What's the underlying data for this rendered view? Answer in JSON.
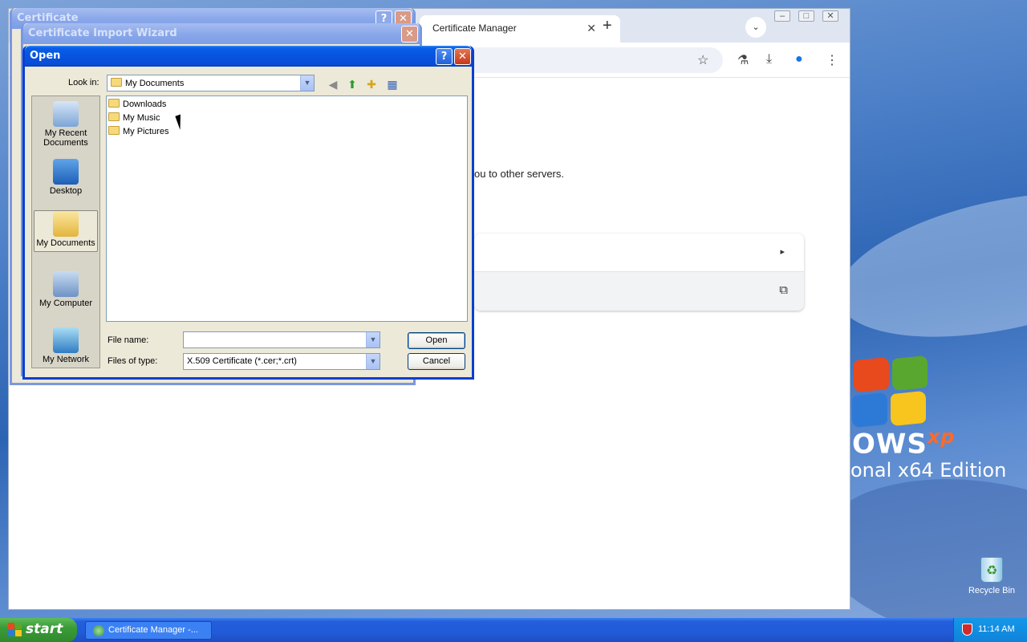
{
  "desktop": {
    "os_brand_text": "OWS",
    "os_brand_sup": "xp",
    "os_edition_text": "onal x64 Edition",
    "recycle_bin_label": "Recycle Bin"
  },
  "browser": {
    "tab_title": "Certificate Manager",
    "tab_close": "✕",
    "new_tab": "+",
    "tab_search": "⌄",
    "content_text": "ou to other servers.",
    "card_arrow": "▸",
    "card_external": "⧉"
  },
  "wizard_back": {
    "title": "Certificate Import Wizard",
    "behind_title": "Certificate"
  },
  "open_dialog": {
    "title": "Open",
    "help_btn": "?",
    "close_btn": "✕",
    "look_in_label": "Look in:",
    "look_in_value": "My Documents",
    "places": [
      {
        "label": "My Recent Documents"
      },
      {
        "label": "Desktop"
      },
      {
        "label": "My Documents"
      },
      {
        "label": "My Computer"
      },
      {
        "label": "My Network"
      }
    ],
    "files": [
      "Downloads",
      "My Music",
      "My Pictures"
    ],
    "file_name_label": "File name:",
    "file_name_value": "",
    "file_type_label": "Files of type:",
    "file_type_value": "X.509 Certificate (*.cer;*.crt)",
    "open_button": "Open",
    "cancel_button": "Cancel"
  },
  "taskbar": {
    "start_label": "start",
    "task_label": "Certificate Manager -...",
    "clock": "11:14 AM"
  }
}
